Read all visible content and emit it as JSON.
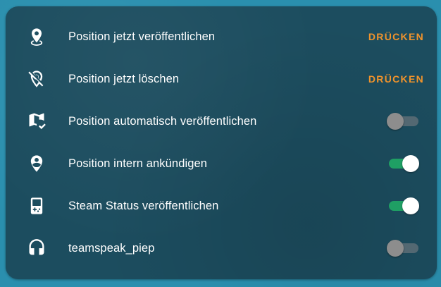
{
  "colors": {
    "card_background": "#1c4d5f",
    "page_background": "#2a8fae",
    "accent_button": "#f0932b",
    "switch_on_track": "#1f9f64",
    "switch_off_knob": "#8d8d8d",
    "text": "#ffffff"
  },
  "entities": [
    {
      "label": "Position jetzt veröffentlichen",
      "icon": "map-marker-radius-icon",
      "control": "button",
      "button_label": "DRÜCKEN"
    },
    {
      "label": "Position jetzt löschen",
      "icon": "map-marker-off-icon",
      "control": "button",
      "button_label": "DRÜCKEN"
    },
    {
      "label": "Position automatisch veröffentlichen",
      "icon": "map-check-icon",
      "control": "switch",
      "state": "off"
    },
    {
      "label": "Position intern ankündigen",
      "icon": "account-location-icon",
      "control": "switch",
      "state": "on"
    },
    {
      "label": "Steam Status veröffentlichen",
      "icon": "gameboy-icon",
      "control": "switch",
      "state": "on"
    },
    {
      "label": "teamspeak_piep",
      "icon": "headphones-icon",
      "control": "switch",
      "state": "off"
    }
  ]
}
